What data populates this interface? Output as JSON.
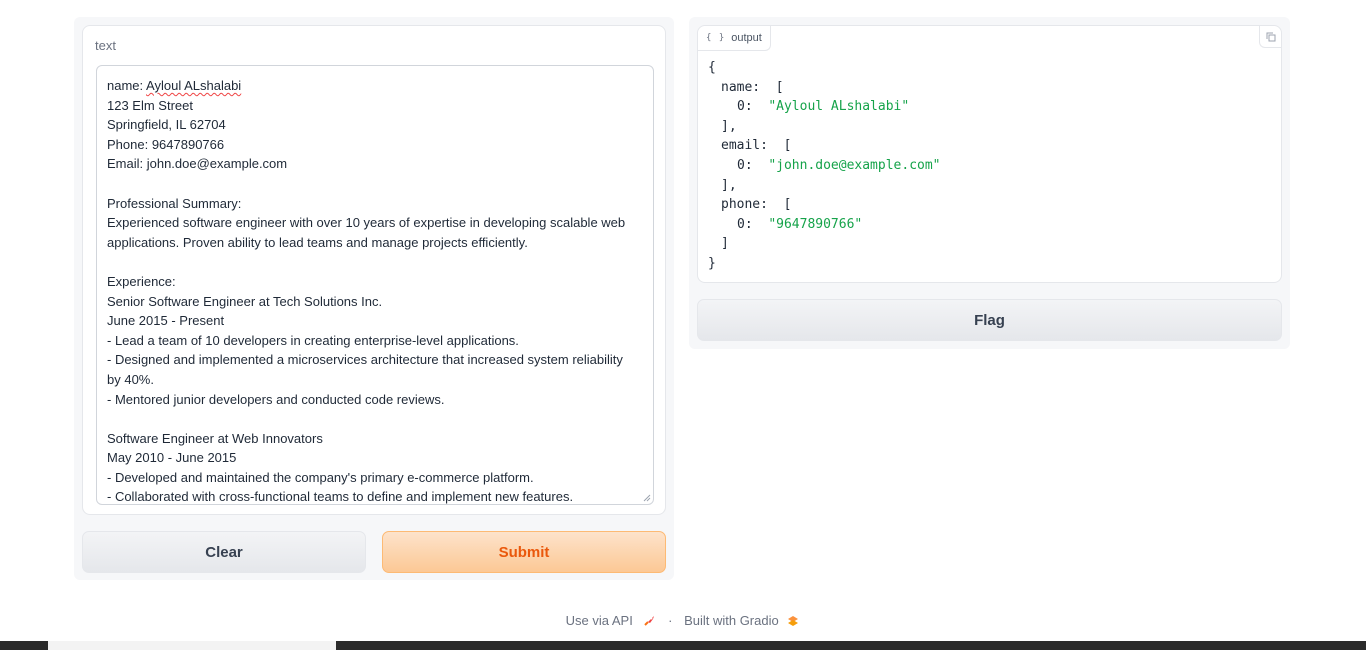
{
  "input": {
    "label": "text",
    "lines": [
      {
        "pre": "name: ",
        "spell": "Ayloul ALshalabi"
      },
      {
        "text": "123 Elm Street"
      },
      {
        "text": "Springfield, IL 62704"
      },
      {
        "text": "Phone: 9647890766"
      },
      {
        "text": "Email: john.doe@example.com"
      },
      {
        "text": ""
      },
      {
        "text": "Professional Summary:"
      },
      {
        "text": "Experienced software engineer with over 10 years of expertise in developing scalable web"
      },
      {
        "text": "applications. Proven ability to lead teams and manage projects efficiently."
      },
      {
        "text": ""
      },
      {
        "text": "Experience:"
      },
      {
        "text": "Senior Software Engineer at Tech Solutions Inc."
      },
      {
        "text": "June 2015 - Present"
      },
      {
        "text": "- Lead a team of 10 developers in creating enterprise-level applications."
      },
      {
        "text": "- Designed and implemented a microservices architecture that increased system reliability"
      },
      {
        "text": "by 40%."
      },
      {
        "text": "- Mentored junior developers and conducted code reviews."
      },
      {
        "text": ""
      },
      {
        "text": "Software Engineer at Web Innovators"
      },
      {
        "text": "May 2010 - June 2015"
      },
      {
        "text": "- Developed and maintained the company's primary e-commerce platform."
      },
      {
        "text": "- Collaborated with cross-functional teams to define and implement new features."
      }
    ]
  },
  "buttons": {
    "clear": "Clear",
    "submit": "Submit",
    "flag": "Flag"
  },
  "output": {
    "label": "output",
    "icon": "{ }",
    "json_lines": [
      {
        "indent": 0,
        "text": "{"
      },
      {
        "indent": 1,
        "key": "name:",
        "punct": "["
      },
      {
        "indent": 2,
        "key": "0:",
        "str": "\"Ayloul ALshalabi\""
      },
      {
        "indent": 1,
        "text": "],"
      },
      {
        "indent": 1,
        "key": "email:",
        "punct": "["
      },
      {
        "indent": 2,
        "key": "0:",
        "str": "\"john.doe@example.com\""
      },
      {
        "indent": 1,
        "text": "],"
      },
      {
        "indent": 1,
        "key": "phone:",
        "punct": "["
      },
      {
        "indent": 2,
        "key": "0:",
        "str": "\"9647890766\""
      },
      {
        "indent": 1,
        "text": "]"
      },
      {
        "indent": 0,
        "text": "}"
      }
    ]
  },
  "footer": {
    "api": "Use via API",
    "separator": "·",
    "built": "Built with Gradio"
  },
  "colors": {
    "accent": "#ea580c",
    "string": "#16a34a"
  }
}
